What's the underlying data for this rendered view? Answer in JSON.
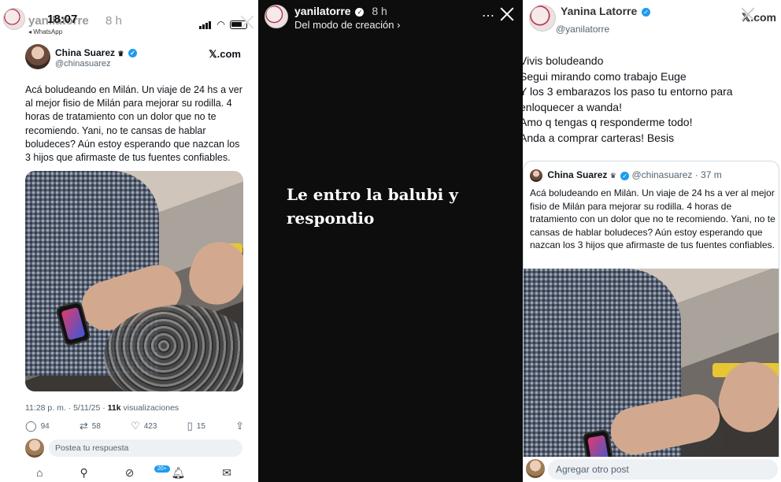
{
  "panel1": {
    "story_user": "yanilatorre",
    "story_time": "8 h",
    "clock": "18:07",
    "back_app": "◂ WhatsApp",
    "tweet": {
      "name": "China Suarez",
      "crown": "♛",
      "handle": "@chinasuarez",
      "brand": "𝕏.com",
      "text": "Acá boludeando en Milán. Un viaje de 24 hs a ver al mejor fisio de Milán para mejorar su rodilla. 4 horas de tratamiento con un dolor que no te recomiendo. Yani, no te cansas de hablar boludeces? Aún estoy esperando que nazcan los 3 hijos que afirmaste de tus fuentes confiables.",
      "meta_time": "11:28 p. m. · 5/11/25 · ",
      "views_count": "11k",
      "views_label": " visualizaciones",
      "replies": "94",
      "retweets": "58",
      "likes": "423",
      "bookmarks": "15",
      "reply_placeholder": "Postea tu respuesta",
      "badge": "20+"
    }
  },
  "panel2": {
    "story_user": "yanilatorre",
    "story_time": "8 h",
    "subtitle": "Del modo de creación ›",
    "caption": "Le entro la balubi y respondio"
  },
  "panel3": {
    "name": "Yanina Latorre",
    "brand": "𝕏.com",
    "handle": "@yanilatorre",
    "text_lines": [
      "Vivis boludeando",
      "Segui mirando como trabajo Euge",
      "Y los 3 embarazos los paso tu entorno para enloquecer a wanda!",
      "Amo q tengas q responderme todo!",
      "Anda a comprar carteras! Besis"
    ],
    "quote": {
      "name": "China Suarez",
      "crown": "♛",
      "handle": "@chinasuarez",
      "time": " · 37 m",
      "text": "Acá boludeando en Milán. Un viaje de 24 hs a ver al mejor fisio de Milán para mejorar su rodilla. 4 horas de tratamiento con un dolor que no te recomiendo. Yani, no te cansas de hablar boludeces? Aún estoy esperando que nazcan los 3 hijos que afirmaste de tus fuentes confiables."
    },
    "reply_placeholder": "Agregar otro post"
  },
  "colors": {
    "verified": "#1d9bf0",
    "story_bg": "#0d0d0d",
    "muted": "#536471"
  },
  "icons": [
    "close-icon",
    "verified-icon",
    "reply-icon",
    "retweet-icon",
    "like-icon",
    "bookmark-icon",
    "share-icon",
    "home-icon",
    "search-icon",
    "grok-icon",
    "notifications-icon",
    "messages-icon"
  ]
}
